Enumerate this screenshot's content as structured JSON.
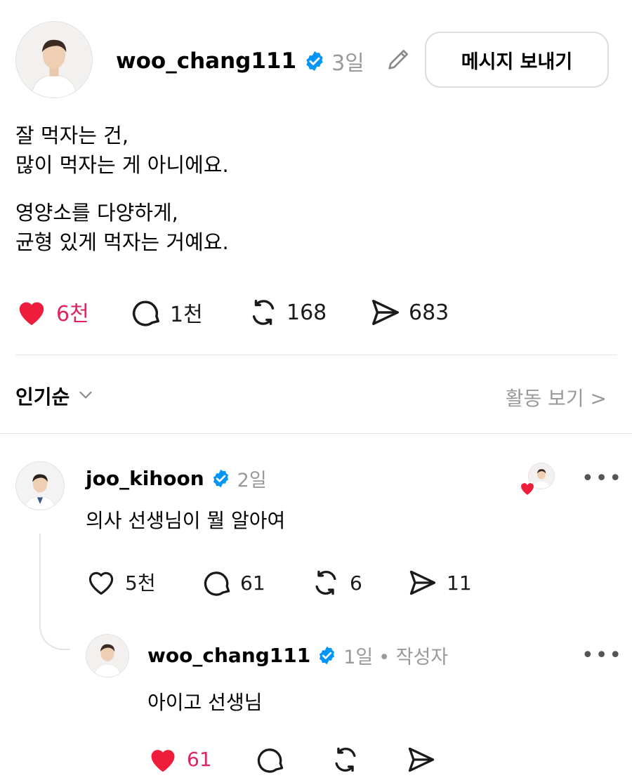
{
  "post": {
    "author": "woo_chang111",
    "time": "3일",
    "message_button": "메시지 보내기",
    "paragraphs": [
      [
        "잘 먹자는 건,",
        "많이 먹자는 게 아니에요."
      ],
      [
        "영양소를 다양하게,",
        "균형 있게 먹자는 거예요."
      ]
    ],
    "likes": "6천",
    "comments": "1천",
    "reposts": "168",
    "shares": "683",
    "icons": [
      "heart-filled-icon",
      "comment-icon",
      "repost-icon",
      "share-icon",
      "pencil-icon",
      "verified-icon"
    ]
  },
  "replies_header": {
    "sort_label": "인기순",
    "activity_link": "활동 보기 >"
  },
  "reply": {
    "author": "joo_kihoon",
    "time": "2일",
    "text": "의사 선생님이 뭘 알아여",
    "likes": "5천",
    "comments": "61",
    "reposts": "6",
    "shares": "11",
    "more": "•••"
  },
  "nested_reply": {
    "author": "woo_chang111",
    "time": "1일",
    "author_badge": "• 작성자",
    "text": "아이고 선생님",
    "likes": "61",
    "more": "•••"
  },
  "colors": {
    "like": "#e0245e",
    "verified": "#0095f6",
    "muted": "#999999"
  }
}
